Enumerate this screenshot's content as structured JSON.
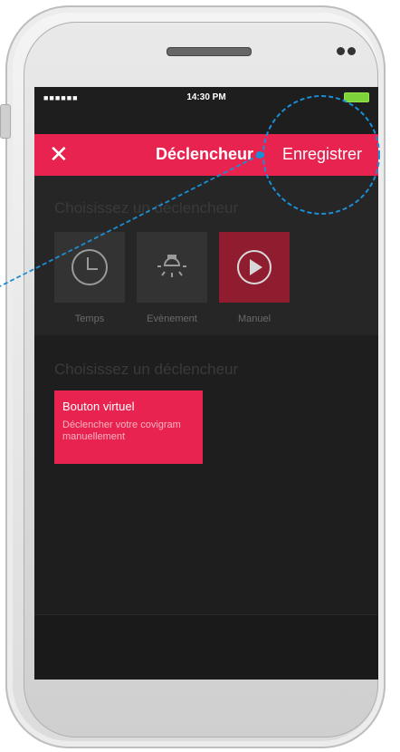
{
  "status_bar": {
    "signal": "■■■■■■",
    "time": "14:30 PM"
  },
  "nav": {
    "close_glyph": "✕",
    "title": "Déclencheur",
    "save_label": "Enregistrer"
  },
  "section1": {
    "heading": "Choisissez un déclencheur"
  },
  "triggers": [
    {
      "icon": "clock-icon",
      "label": "Temps"
    },
    {
      "icon": "lightbulb-icon",
      "label": "Evènement"
    },
    {
      "icon": "play-icon",
      "label": "Manuel"
    }
  ],
  "section2": {
    "heading": "Choisissez un déclencheur"
  },
  "card": {
    "title": "Bouton virtuel",
    "description": "Déclencher votre covigram manuellement"
  },
  "colors": {
    "accent": "#e8234f",
    "selected_tile": "#8f1d2f",
    "annotation": "#1a8fd6",
    "background": "#1e1e1e"
  }
}
